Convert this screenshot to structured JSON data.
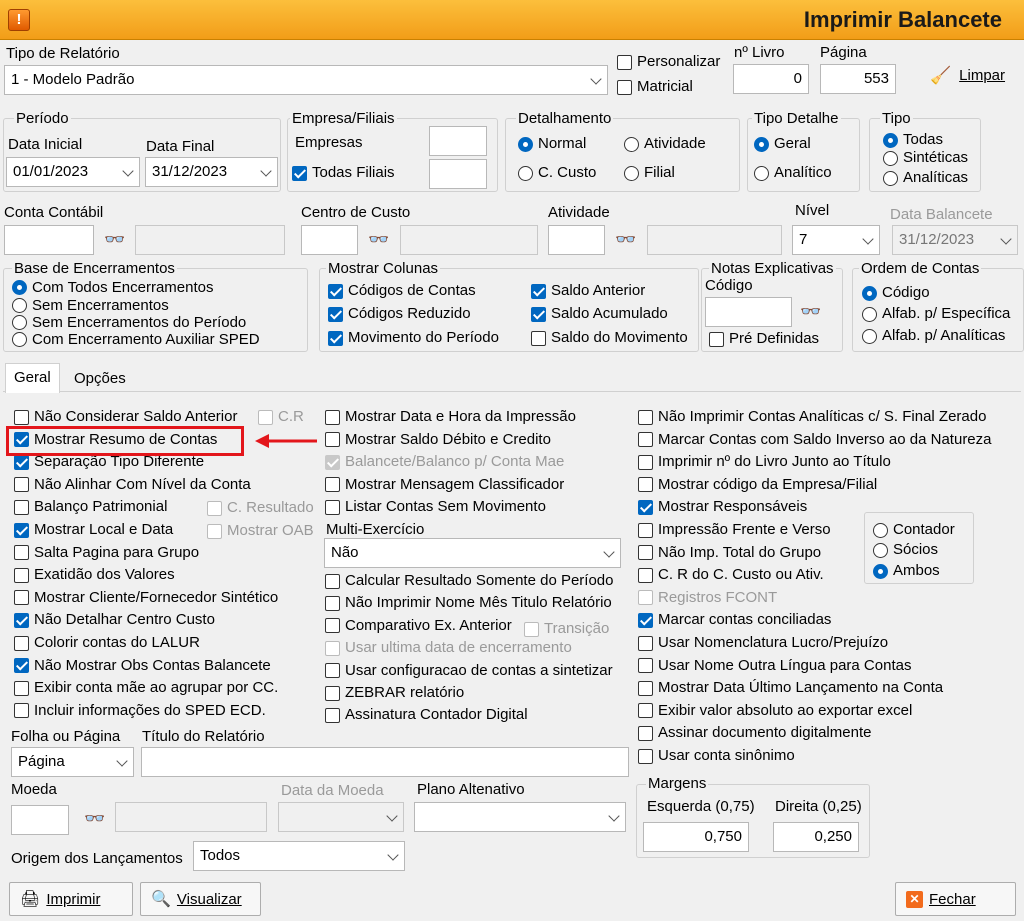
{
  "window": {
    "title": "Imprimir Balancete",
    "icon": "app-warning-icon"
  },
  "tipo_relatorio": {
    "label": "Tipo de Relatório",
    "value": "1 - Modelo Padrão"
  },
  "personalizar": {
    "label": "Personalizar",
    "checked": false
  },
  "matricial": {
    "label": "Matricial",
    "checked": false
  },
  "livro": {
    "label": "nº Livro",
    "value": "0"
  },
  "pagina": {
    "label": "Página",
    "value": "553"
  },
  "limpar_button": {
    "label": "Limpar",
    "icon": "broom-icon"
  },
  "periodo": {
    "label": "Período",
    "data_inicial_label": "Data Inicial",
    "data_inicial": "01/01/2023",
    "data_final_label": "Data Final",
    "data_final": "31/12/2023"
  },
  "empresa": {
    "label": "Empresa/Filiais",
    "empresas_label": "Empresas",
    "todas_filiais": "Todas Filiais"
  },
  "detalhamento": {
    "label": "Detalhamento",
    "options": [
      "Normal",
      "Atividade",
      "C. Custo",
      "Filial"
    ],
    "selected": "Normal"
  },
  "tipo_detalhe": {
    "label": "Tipo Detalhe",
    "options": [
      "Geral",
      "Analítico"
    ],
    "selected": "Geral"
  },
  "tipo": {
    "label": "Tipo",
    "options": [
      "Todas",
      "Sintéticas",
      "Analíticas"
    ],
    "selected": "Todas"
  },
  "conta_contabil": {
    "label": "Conta Contábil"
  },
  "centro_custo": {
    "label": "Centro de Custo"
  },
  "atividade": {
    "label": "Atividade"
  },
  "nivel": {
    "label": "Nível",
    "value": "7"
  },
  "data_balancete": {
    "label": "Data Balancete",
    "value": "31/12/2023"
  },
  "base_encerramentos": {
    "label": "Base de Encerramentos",
    "options": [
      "Com Todos Encerramentos",
      "Sem Encerramentos",
      "Sem Encerramentos do Período",
      "Com Encerramento Auxiliar SPED"
    ],
    "selected": "Com Todos Encerramentos"
  },
  "mostrar_colunas": {
    "label": "Mostrar Colunas",
    "codigos_contas": "Códigos de Contas",
    "codigos_reduzido": "Códigos Reduzido",
    "movimento_periodo": "Movimento do Período",
    "saldo_anterior": "Saldo Anterior",
    "saldo_acumulado": "Saldo Acumulado",
    "saldo_movimento": "Saldo do Movimento"
  },
  "notas": {
    "label": "Notas Explicativas",
    "codigo_label": "Código",
    "pre_definidas": "Pré Definidas"
  },
  "ordem_contas": {
    "label": "Ordem de Contas",
    "options": [
      "Código",
      "Alfab. p/  Específica",
      "Alfab. p/ Analíticas"
    ],
    "selected": "Código"
  },
  "tabs": [
    {
      "label": "Geral",
      "active": true
    },
    {
      "label": "Opções",
      "active": false
    }
  ],
  "col1": [
    {
      "label": "Não Considerar Saldo Anterior",
      "state": "off"
    },
    {
      "label": "Mostrar Resumo de Contas",
      "state": "on"
    },
    {
      "label": "Separação Tipo Diferente",
      "state": "on"
    },
    {
      "label": "Não Alinhar Com Nível da Conta",
      "state": "off"
    },
    {
      "label": "Balanço Patrimonial",
      "state": "off"
    },
    {
      "label": "Mostrar Local e Data",
      "state": "on"
    },
    {
      "label": "Salta Pagina para Grupo",
      "state": "off"
    },
    {
      "label": "Exatidão dos Valores",
      "state": "off"
    },
    {
      "label": "Mostrar Cliente/Fornecedor Sintético",
      "state": "off"
    },
    {
      "label": "Não Detalhar Centro Custo",
      "state": "on"
    },
    {
      "label": "Colorir contas do LALUR",
      "state": "off"
    },
    {
      "label": "Não Mostrar Obs Contas Balancete",
      "state": "on"
    },
    {
      "label": "Exibir conta mãe ao agrupar por CC.",
      "state": "off"
    },
    {
      "label": "Incluir informações do SPED ECD.",
      "state": "off"
    }
  ],
  "col1_sub": {
    "cr": "C.R",
    "c_resultado": "C. Resultado",
    "mostrar_oab": "Mostrar OAB"
  },
  "col2a": [
    {
      "label": "Mostrar Data e Hora da Impressão",
      "state": "off"
    },
    {
      "label": "Mostrar Saldo Débito e Credito",
      "state": "off"
    },
    {
      "label": "Balancete/Balanco p/ Conta Mae",
      "state": "dison"
    },
    {
      "label": "Mostrar Mensagem Classificador",
      "state": "off"
    },
    {
      "label": "Listar Contas Sem Movimento",
      "state": "off"
    }
  ],
  "multi_exercicio": {
    "label": "Multi-Exercício",
    "value": "Não"
  },
  "col2b": [
    {
      "label": "Calcular Resultado Somente do Período",
      "state": "off"
    },
    {
      "label": "Não Imprimir Nome Mês Titulo Relatório",
      "state": "off"
    },
    {
      "label": "Comparativo Ex. Anterior",
      "state": "off"
    },
    {
      "label": "Usar ultima data de encerramento",
      "state": "dis"
    },
    {
      "label": "Usar configuracao de contas a sintetizar",
      "state": "off"
    },
    {
      "label": "ZEBRAR relatório",
      "state": "off"
    },
    {
      "label": "Assinatura Contador Digital",
      "state": "off"
    }
  ],
  "transicao": "Transição",
  "col3": [
    {
      "label": "Não Imprimir Contas Analíticas c/ S. Final Zerado",
      "state": "off"
    },
    {
      "label": "Marcar Contas com Saldo Inverso ao da Natureza",
      "state": "off"
    },
    {
      "label": "Imprimir nº do Livro Junto ao Título",
      "state": "off"
    },
    {
      "label": "Mostrar código da Empresa/Filial",
      "state": "off"
    },
    {
      "label": "Mostrar Responsáveis",
      "state": "on"
    },
    {
      "label": "Impressão Frente e Verso",
      "state": "off"
    },
    {
      "label": "Não Imp. Total do Grupo",
      "state": "off"
    },
    {
      "label": "C. R do C. Custo ou Ativ.",
      "state": "off"
    },
    {
      "label": "Registros FCONT",
      "state": "dis"
    },
    {
      "label": "Marcar contas conciliadas",
      "state": "on"
    },
    {
      "label": "Usar Nomenclatura Lucro/Prejuízo",
      "state": "off"
    },
    {
      "label": "Usar Nome Outra Língua para Contas",
      "state": "off"
    },
    {
      "label": "Mostrar Data Último Lançamento na Conta",
      "state": "off"
    },
    {
      "label": "Exibir valor absoluto ao exportar excel",
      "state": "off"
    },
    {
      "label": "Assinar documento digitalmente",
      "state": "off"
    },
    {
      "label": "Usar conta sinônimo",
      "state": "off"
    }
  ],
  "responsaveis": {
    "options": [
      "Contador",
      "Sócios",
      "Ambos"
    ],
    "selected": "Ambos"
  },
  "margens": {
    "label": "Margens",
    "esquerda_label": "Esquerda (0,75)",
    "esquerda": "0,750",
    "direita_label": "Direita (0,25)",
    "direita": "0,250"
  },
  "folha_pagina": {
    "label": "Folha ou Página",
    "value": "Página"
  },
  "titulo_relatorio": {
    "label": "Título do Relatório",
    "value": ""
  },
  "moeda": {
    "label": "Moeda"
  },
  "data_moeda": {
    "label": "Data da Moeda"
  },
  "plano": {
    "label": "Plano Altenativo"
  },
  "origem": {
    "label": "Origem dos Lançamentos",
    "value": "Todos"
  },
  "buttons": {
    "imprimir": "Imprimir",
    "visualizar": "Visualizar",
    "fechar": "Fechar"
  },
  "colors": {
    "accent": "#0067c0",
    "title_bar": "#f7ae29",
    "highlight": "#e3161b"
  }
}
